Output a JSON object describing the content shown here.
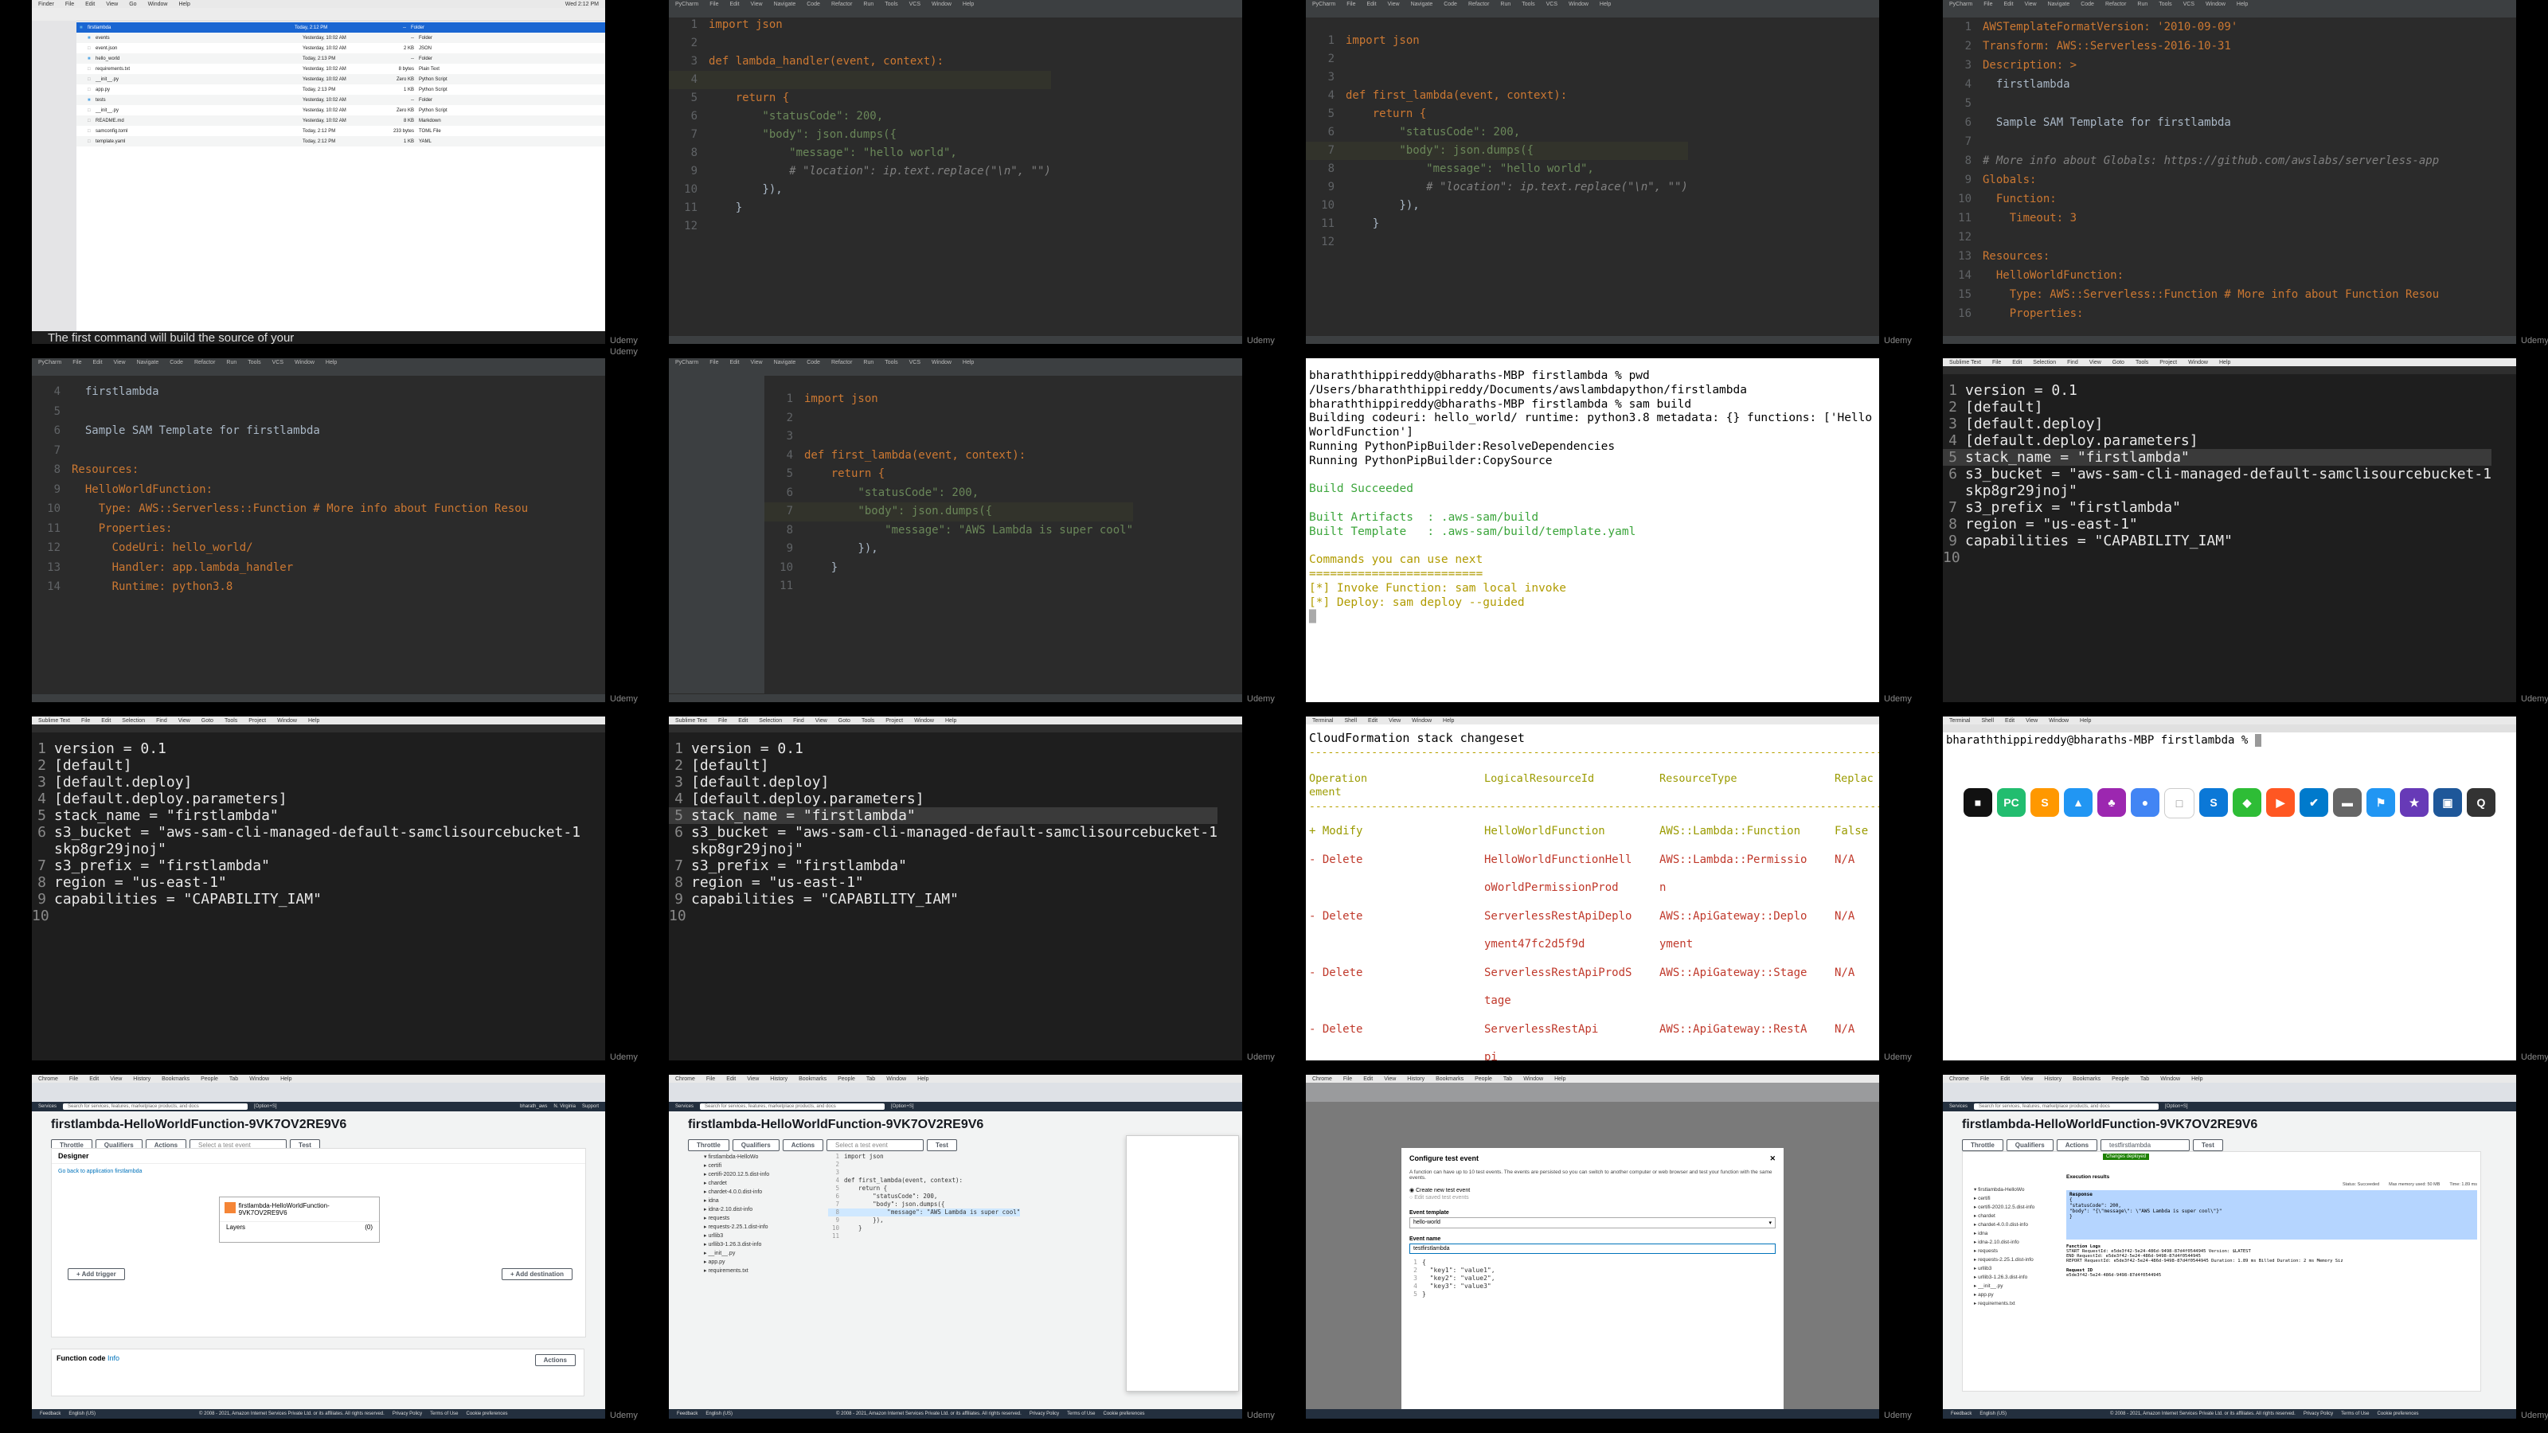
{
  "watermark": "Udemy",
  "finder": {
    "caption": "The first command will build the source of your",
    "rows": [
      {
        "name": "firstlambda",
        "date": "Today, 2:12 PM",
        "size": "--",
        "kind": "Folder"
      },
      {
        "name": "events",
        "date": "Yesterday, 10:02 AM",
        "size": "--",
        "kind": "Folder"
      },
      {
        "name": "event.json",
        "date": "Yesterday, 10:02 AM",
        "size": "2 KB",
        "kind": "JSON"
      },
      {
        "name": "hello_world",
        "date": "Today, 2:13 PM",
        "size": "--",
        "kind": "Folder"
      },
      {
        "name": "requirements.txt",
        "date": "Yesterday, 10:02 AM",
        "size": "8 bytes",
        "kind": "Plain Text"
      },
      {
        "name": "__init__.py",
        "date": "Yesterday, 10:02 AM",
        "size": "Zero KB",
        "kind": "Python Script"
      },
      {
        "name": "app.py",
        "date": "Today, 2:13 PM",
        "size": "1 KB",
        "kind": "Python Script"
      },
      {
        "name": "tests",
        "date": "Yesterday, 10:02 AM",
        "size": "--",
        "kind": "Folder"
      },
      {
        "name": "__init__.py",
        "date": "Yesterday, 10:02 AM",
        "size": "Zero KB",
        "kind": "Python Script"
      },
      {
        "name": "README.md",
        "date": "Yesterday, 10:02 AM",
        "size": "8 KB",
        "kind": "Markdown"
      },
      {
        "name": "samconfig.toml",
        "date": "Today, 2:12 PM",
        "size": "233 bytes",
        "kind": "TOML File"
      },
      {
        "name": "template.yaml",
        "date": "Today, 2:12 PM",
        "size": "1 KB",
        "kind": "YAML"
      }
    ]
  },
  "code_handler": {
    "lines": [
      {
        "n": "1",
        "t": "import json"
      },
      {
        "n": "2",
        "t": ""
      },
      {
        "n": "3",
        "t": "def lambda_handler(event, context):"
      },
      {
        "n": "4",
        "t": ""
      },
      {
        "n": "5",
        "t": "    return {"
      },
      {
        "n": "6",
        "t": "        \"statusCode\": 200,"
      },
      {
        "n": "7",
        "t": "        \"body\": json.dumps({"
      },
      {
        "n": "8",
        "t": "            \"message\": \"hello world\","
      },
      {
        "n": "9",
        "t": "            # \"location\": ip.text.replace(\"\\n\", \"\")"
      },
      {
        "n": "10",
        "t": "        }),"
      },
      {
        "n": "11",
        "t": "    }"
      },
      {
        "n": "12",
        "t": ""
      }
    ]
  },
  "code_first": {
    "lines": [
      {
        "n": "1",
        "t": "import json"
      },
      {
        "n": "2",
        "t": ""
      },
      {
        "n": "3",
        "t": ""
      },
      {
        "n": "4",
        "t": "def first_lambda(event, context):"
      },
      {
        "n": "5",
        "t": "    return {"
      },
      {
        "n": "6",
        "t": "        \"statusCode\": 200,"
      },
      {
        "n": "7",
        "t": "        \"body\": json.dumps({"
      },
      {
        "n": "8",
        "t": "            \"message\": \"hello world\","
      },
      {
        "n": "9",
        "t": "            # \"location\": ip.text.replace(\"\\n\", \"\")"
      },
      {
        "n": "10",
        "t": "        }),"
      },
      {
        "n": "11",
        "t": "    }"
      },
      {
        "n": "12",
        "t": ""
      }
    ]
  },
  "template_top": {
    "lines": [
      {
        "n": "1",
        "t": "AWSTemplateFormatVersion: '2010-09-09'"
      },
      {
        "n": "2",
        "t": "Transform: AWS::Serverless-2016-10-31"
      },
      {
        "n": "3",
        "t": "Description: >"
      },
      {
        "n": "4",
        "t": "  firstlambda"
      },
      {
        "n": "5",
        "t": ""
      },
      {
        "n": "6",
        "t": "  Sample SAM Template for firstlambda"
      },
      {
        "n": "7",
        "t": ""
      },
      {
        "n": "8",
        "t": "# More info about Globals: https://github.com/awslabs/serverless-app"
      },
      {
        "n": "9",
        "t": "Globals:"
      },
      {
        "n": "10",
        "t": "  Function:"
      },
      {
        "n": "11",
        "t": "    Timeout: 3"
      },
      {
        "n": "12",
        "t": ""
      },
      {
        "n": "13",
        "t": "Resources:"
      },
      {
        "n": "14",
        "t": "  HelloWorldFunction:"
      },
      {
        "n": "15",
        "t": "    Type: AWS::Serverless::Function # More info about Function Resou"
      },
      {
        "n": "16",
        "t": "    Properties:"
      }
    ]
  },
  "template_bottom": {
    "lines": [
      {
        "n": "4",
        "t": "  firstlambda"
      },
      {
        "n": "5",
        "t": ""
      },
      {
        "n": "6",
        "t": "  Sample SAM Template for firstlambda"
      },
      {
        "n": "7",
        "t": ""
      },
      {
        "n": "8",
        "t": "Resources:"
      },
      {
        "n": "9",
        "t": "  HelloWorldFunction:"
      },
      {
        "n": "10",
        "t": "    Type: AWS::Serverless::Function # More info about Function Resou"
      },
      {
        "n": "11",
        "t": "    Properties:"
      },
      {
        "n": "12",
        "t": "      CodeUri: hello_world/"
      },
      {
        "n": "13",
        "t": "      Handler: app.lambda_handler"
      },
      {
        "n": "14",
        "t": "      Runtime: python3.8"
      }
    ]
  },
  "code_super": {
    "lines": [
      {
        "n": "1",
        "t": "import json"
      },
      {
        "n": "2",
        "t": ""
      },
      {
        "n": "3",
        "t": ""
      },
      {
        "n": "4",
        "t": "def first_lambda(event, context):"
      },
      {
        "n": "5",
        "t": "    return {"
      },
      {
        "n": "6",
        "t": "        \"statusCode\": 200,"
      },
      {
        "n": "7",
        "t": "        \"body\": json.dumps({"
      },
      {
        "n": "8",
        "t": "            \"message\": \"AWS Lambda is super cool\""
      },
      {
        "n": "9",
        "t": "        }),"
      },
      {
        "n": "10",
        "t": "    }"
      },
      {
        "n": "11",
        "t": ""
      }
    ]
  },
  "terminal_build": {
    "lines": [
      "bharaththippireddy@bharaths-MBP firstlambda % pwd",
      "/Users/bharaththippireddy/Documents/awslambdapython/firstlambda",
      "bharaththippireddy@bharaths-MBP firstlambda % sam build",
      "Building codeuri: hello_world/ runtime: python3.8 metadata: {} functions: ['Hello",
      "WorldFunction']",
      "Running PythonPipBuilder:ResolveDependencies",
      "Running PythonPipBuilder:CopySource",
      "",
      "Build Succeeded",
      "",
      "Built Artifacts  : .aws-sam/build",
      "Built Template   : .aws-sam/build/template.yaml",
      "",
      "Commands you can use next",
      "=========================",
      "[*] Invoke Function: sam local invoke",
      "[*] Deploy: sam deploy --guided"
    ]
  },
  "samconfig": {
    "lines": [
      {
        "n": "1",
        "t": "version = 0.1"
      },
      {
        "n": "2",
        "t": "[default]"
      },
      {
        "n": "3",
        "t": "[default.deploy]"
      },
      {
        "n": "4",
        "t": "[default.deploy.parameters]"
      },
      {
        "n": "5",
        "t": "stack_name = \"firstlambda\""
      },
      {
        "n": "6",
        "t": "s3_bucket = \"aws-sam-cli-managed-default-samclisourcebucket-1"
      },
      {
        "n": "",
        "t": "skp8gr29jnoj\""
      },
      {
        "n": "7",
        "t": "s3_prefix = \"firstlambda\""
      },
      {
        "n": "8",
        "t": "region = \"us-east-1\""
      },
      {
        "n": "9",
        "t": "capabilities = \"CAPABILITY_IAM\""
      },
      {
        "n": "10",
        "t": ""
      }
    ]
  },
  "changeset": {
    "title": "CloudFormation stack changeset",
    "headers": [
      "Operation",
      "LogicalResourceId",
      "ResourceType",
      "Replac"
    ],
    "header_wrap": "ement",
    "rows": [
      {
        "op": "+ Modify",
        "id": "HelloWorldFunction",
        "type": "AWS::Lambda::Function",
        "rep": "False"
      },
      {
        "op": "- Delete",
        "id": "HelloWorldFunctionHell",
        "type": "AWS::Lambda::Permissio",
        "rep": "N/A"
      },
      {
        "op": "",
        "id": "oWorldPermissionProd",
        "type": "n",
        "rep": ""
      },
      {
        "op": "- Delete",
        "id": "ServerlessRestApiDeplo",
        "type": "AWS::ApiGateway::Deplo",
        "rep": "N/A"
      },
      {
        "op": "",
        "id": "yment47fc2d5f9d",
        "type": "yment",
        "rep": ""
      },
      {
        "op": "- Delete",
        "id": "ServerlessRestApiProdS",
        "type": "AWS::ApiGateway::Stage",
        "rep": "N/A"
      },
      {
        "op": "",
        "id": "tage",
        "type": "",
        "rep": ""
      },
      {
        "op": "- Delete",
        "id": "ServerlessRestApi",
        "type": "AWS::ApiGateway::RestA",
        "rep": "N/A"
      },
      {
        "op": "",
        "id": "pi",
        "type": "",
        "rep": ""
      }
    ]
  },
  "terminal_prompt": {
    "prompt": "bharaththippireddy@bharaths-MBP firstlambda % ",
    "dock": [
      "■",
      "PC",
      "S",
      "▲",
      "♣",
      "●",
      "□",
      "S",
      "◆",
      "▶",
      "✔",
      "▬",
      "⚑",
      "★",
      "▣",
      "Q"
    ]
  },
  "aws": {
    "services": "Services",
    "search_placeholder": "Search for services, features, marketplace products, and docs",
    "shortcut": "[Option+S]",
    "user": "bharath_aws",
    "region": "N. Virginia",
    "support": "Support",
    "function_title": "firstlambda-HelloWorldFunction-9VK7OV2RE9V6",
    "throttle": "Throttle",
    "qualifiers": "Qualifiers",
    "actions": "Actions",
    "select_event": "Select a test event",
    "test": "Test",
    "designer": "Designer",
    "back_link": "Go back to application firstlambda",
    "function_box": "firstlambda-HelloWorldFunction-9VK7OV2RE9V6",
    "layers": "Layers",
    "layers_count": "(0)",
    "add_trigger": "+ Add trigger",
    "add_destination": "+ Add destination",
    "function_code": "Function code",
    "info": "Info",
    "footer_feedback": "Feedback",
    "footer_lang": "English (US)",
    "footer_copy": "© 2008 - 2021, Amazon Internet Services Private Ltd. or its affiliates. All rights reserved.",
    "footer_privacy": "Privacy Policy",
    "footer_terms": "Terms of Use",
    "footer_cookie": "Cookie preferences",
    "editor_lines": [
      {
        "n": "1",
        "t": "import json"
      },
      {
        "n": "2",
        "t": ""
      },
      {
        "n": "3",
        "t": ""
      },
      {
        "n": "4",
        "t": "def first_lambda(event, context):"
      },
      {
        "n": "5",
        "t": "    return {"
      },
      {
        "n": "6",
        "t": "        \"statusCode\": 200,"
      },
      {
        "n": "7",
        "t": "        \"body\": json.dumps({"
      },
      {
        "n": "8",
        "t": "            \"message\": \"AWS Lambda is super cool\""
      },
      {
        "n": "9",
        "t": "        }),"
      },
      {
        "n": "10",
        "t": "    }"
      },
      {
        "n": "11",
        "t": ""
      }
    ],
    "tree": [
      "firstlambda-HelloWo",
      "certifi",
      "certifi-2020.12.5.dist-info",
      "chardet",
      "chardet-4.0.0.dist-info",
      "idna",
      "idna-2.10.dist-info",
      "requests",
      "requests-2.25.1.dist-info",
      "urllib3",
      "urllib3-1.26.3.dist-info",
      "__init__.py",
      "app.py",
      "requirements.txt"
    ],
    "modal": {
      "title": "Configure test event",
      "desc": "A function can have up to 10 test events. The events are persisted so you can switch to another computer or web browser and test your function with the same events.",
      "create_new": "Create new test event",
      "edit_saved": "Edit saved test events",
      "template_label": "Event template",
      "template_value": "hello-world",
      "name_label": "Event name",
      "name_value": "testfirstlambda",
      "json_lines": [
        {
          "n": "1",
          "t": "{"
        },
        {
          "n": "2",
          "t": "  \"key1\": \"value1\","
        },
        {
          "n": "3",
          "t": "  \"key2\": \"value2\","
        },
        {
          "n": "4",
          "t": "  \"key3\": \"value3\""
        },
        {
          "n": "5",
          "t": "}"
        }
      ]
    },
    "result": {
      "event_selected": "testfirstlambda",
      "deploy_badge": "Changes deployed",
      "tab": "Execution results",
      "status": "Status: Succeeded",
      "max_memory": "Max memory used: 50 MB",
      "time": "Time: 1.89 ms",
      "response_label": "Response",
      "response_lines": [
        "{",
        "  \"statusCode\": 200,",
        "  \"body\": \"{\\\"message\\\": \\\"AWS Lambda is super cool\\\"}\"",
        "}"
      ],
      "log_label": "Function Logs",
      "log_lines": [
        "START RequestId: e5de3f42-5e24-486d-9498-87d4f0544945 Version: $LATEST",
        "END RequestId: e5de3f42-5e24-486d-9498-87d4f0544945",
        "REPORT RequestId: e5de3f42-5e24-486d-9498-87d4f0544945  Duration: 1.89 ms  Billed Duration: 2 ms  Memory Siz"
      ],
      "request_label": "Request ID",
      "request_id": "e5de3f42-5e24-486d-9498-87d4f0544945"
    }
  }
}
